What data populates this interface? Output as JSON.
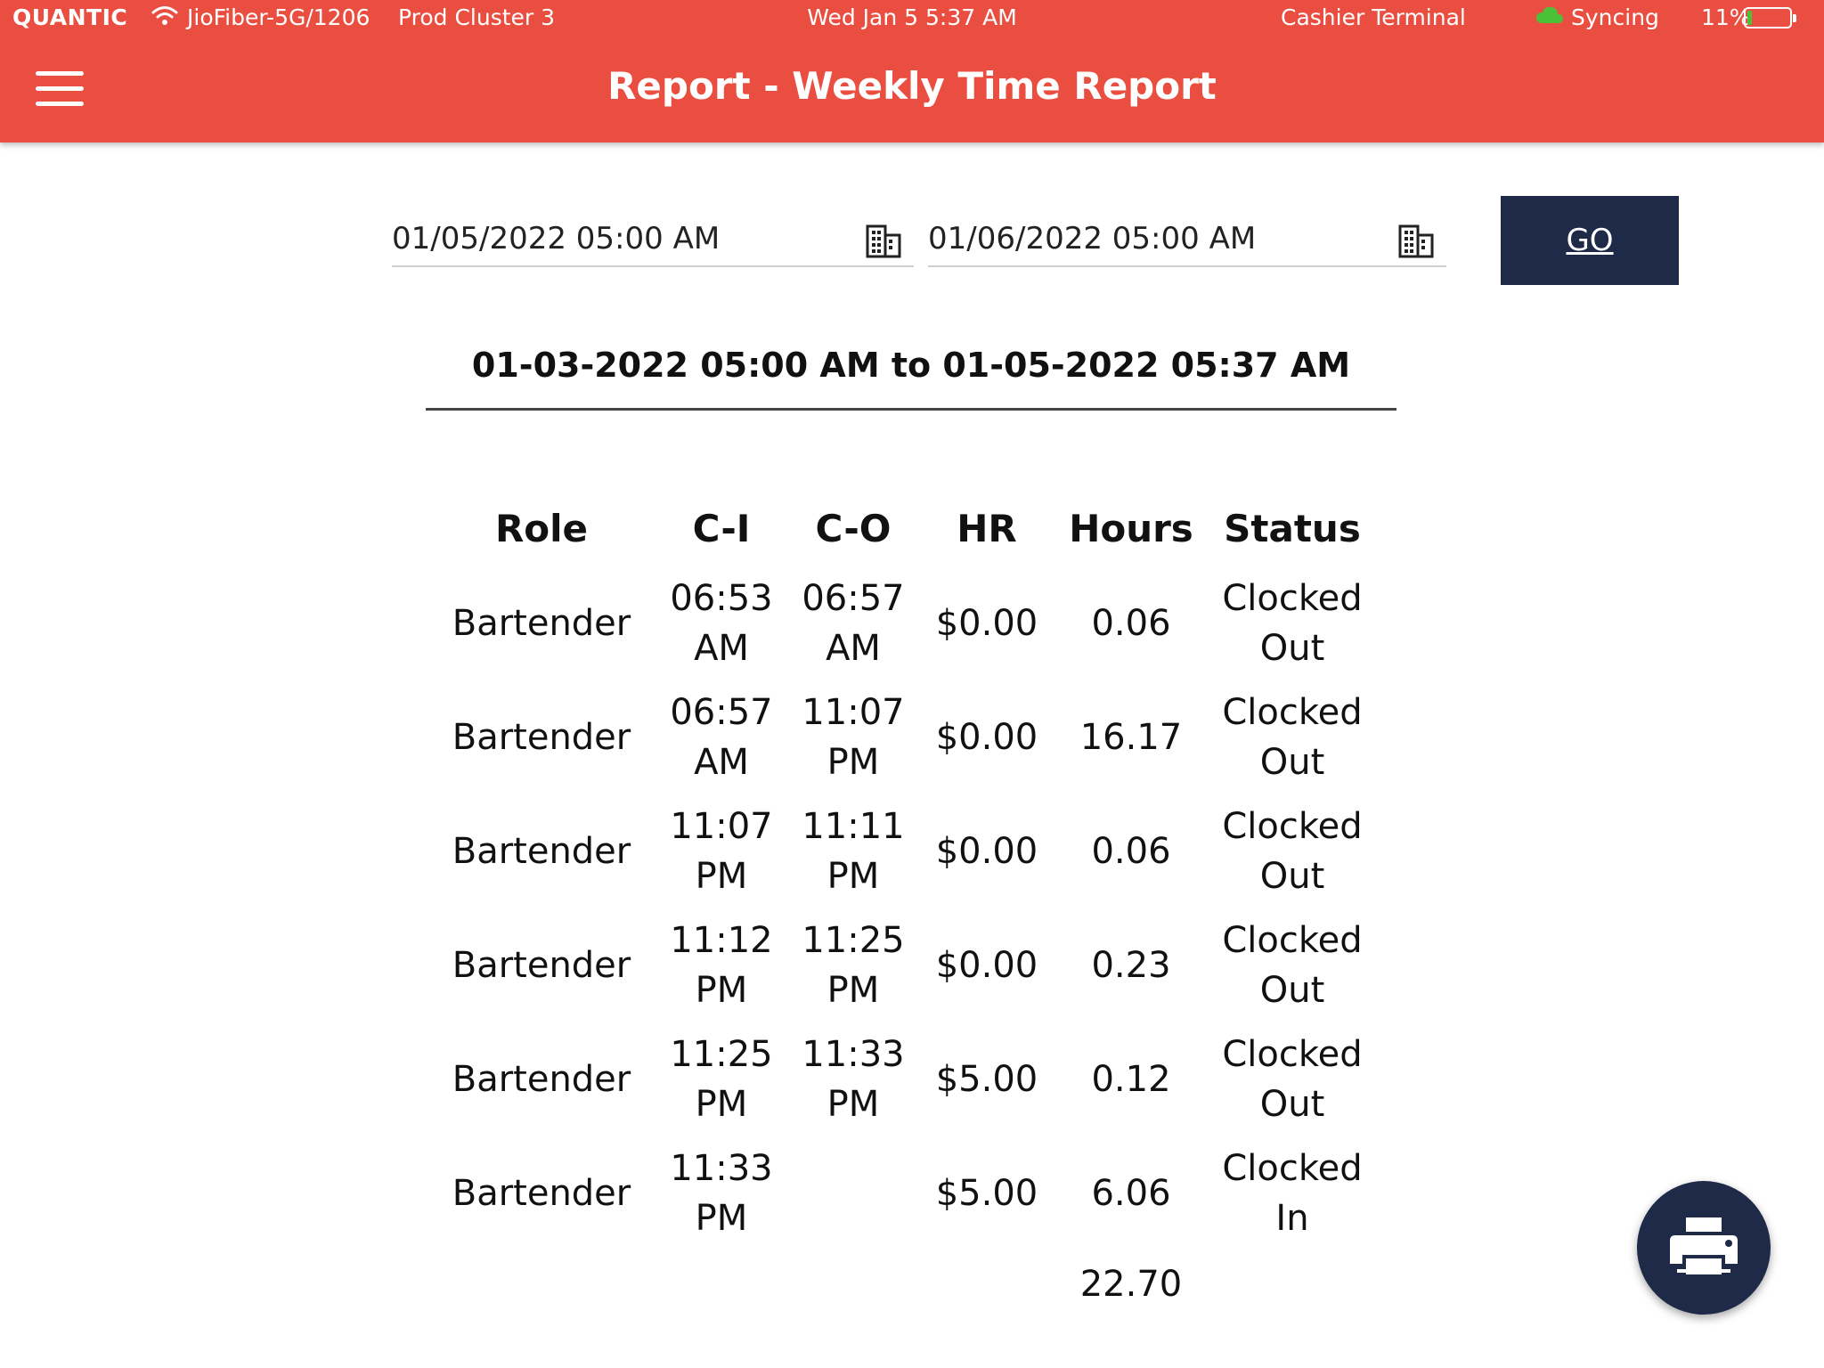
{
  "status_bar": {
    "brand": "QUANTIC",
    "network": "JioFiber-5G/1206",
    "cluster": "Prod Cluster 3",
    "datetime": "Wed Jan 5 5:37 AM",
    "terminal": "Cashier Terminal",
    "sync": "Syncing",
    "battery_pct": "11%",
    "battery_level": 0.11,
    "icons": [
      "wifi-icon",
      "cloud-icon",
      "battery-icon"
    ]
  },
  "header": {
    "title": "Report - Weekly Time Report",
    "menu_icon": "menu-icon"
  },
  "filters": {
    "start_date": "01/05/2022 05:00 AM",
    "end_date": "01/06/2022 05:00 AM",
    "calendar_icon": "calendar-icon",
    "go_label": "GO"
  },
  "range_label": "01-03-2022 05:00 AM to 01-05-2022 05:37 AM",
  "table": {
    "headers": [
      "Role",
      "C-I",
      "C-O",
      "HR",
      "Hours",
      "Status"
    ],
    "rows": [
      {
        "role": "Bartender",
        "ci": "06:53 AM",
        "co": "06:57 AM",
        "hr": "$0.00",
        "hours": "0.06",
        "status": "Clocked Out"
      },
      {
        "role": "Bartender",
        "ci": "06:57 AM",
        "co": "11:07 PM",
        "hr": "$0.00",
        "hours": "16.17",
        "status": "Clocked Out"
      },
      {
        "role": "Bartender",
        "ci": "11:07 PM",
        "co": "11:11 PM",
        "hr": "$0.00",
        "hours": "0.06",
        "status": "Clocked Out"
      },
      {
        "role": "Bartender",
        "ci": "11:12 PM",
        "co": "11:25 PM",
        "hr": "$0.00",
        "hours": "0.23",
        "status": "Clocked Out"
      },
      {
        "role": "Bartender",
        "ci": "11:25 PM",
        "co": "11:33 PM",
        "hr": "$5.00",
        "hours": "0.12",
        "status": "Clocked Out"
      },
      {
        "role": "Bartender",
        "ci": "11:33 PM",
        "co": "",
        "hr": "$5.00",
        "hours": "6.06",
        "status": "Clocked In"
      }
    ],
    "total_hours": "22.70"
  },
  "print_icon": "printer-icon",
  "colors": {
    "header": "#e94e40",
    "navy": "#1e2a48",
    "battery": "#4bc13a",
    "cloud": "#4bc13a"
  }
}
